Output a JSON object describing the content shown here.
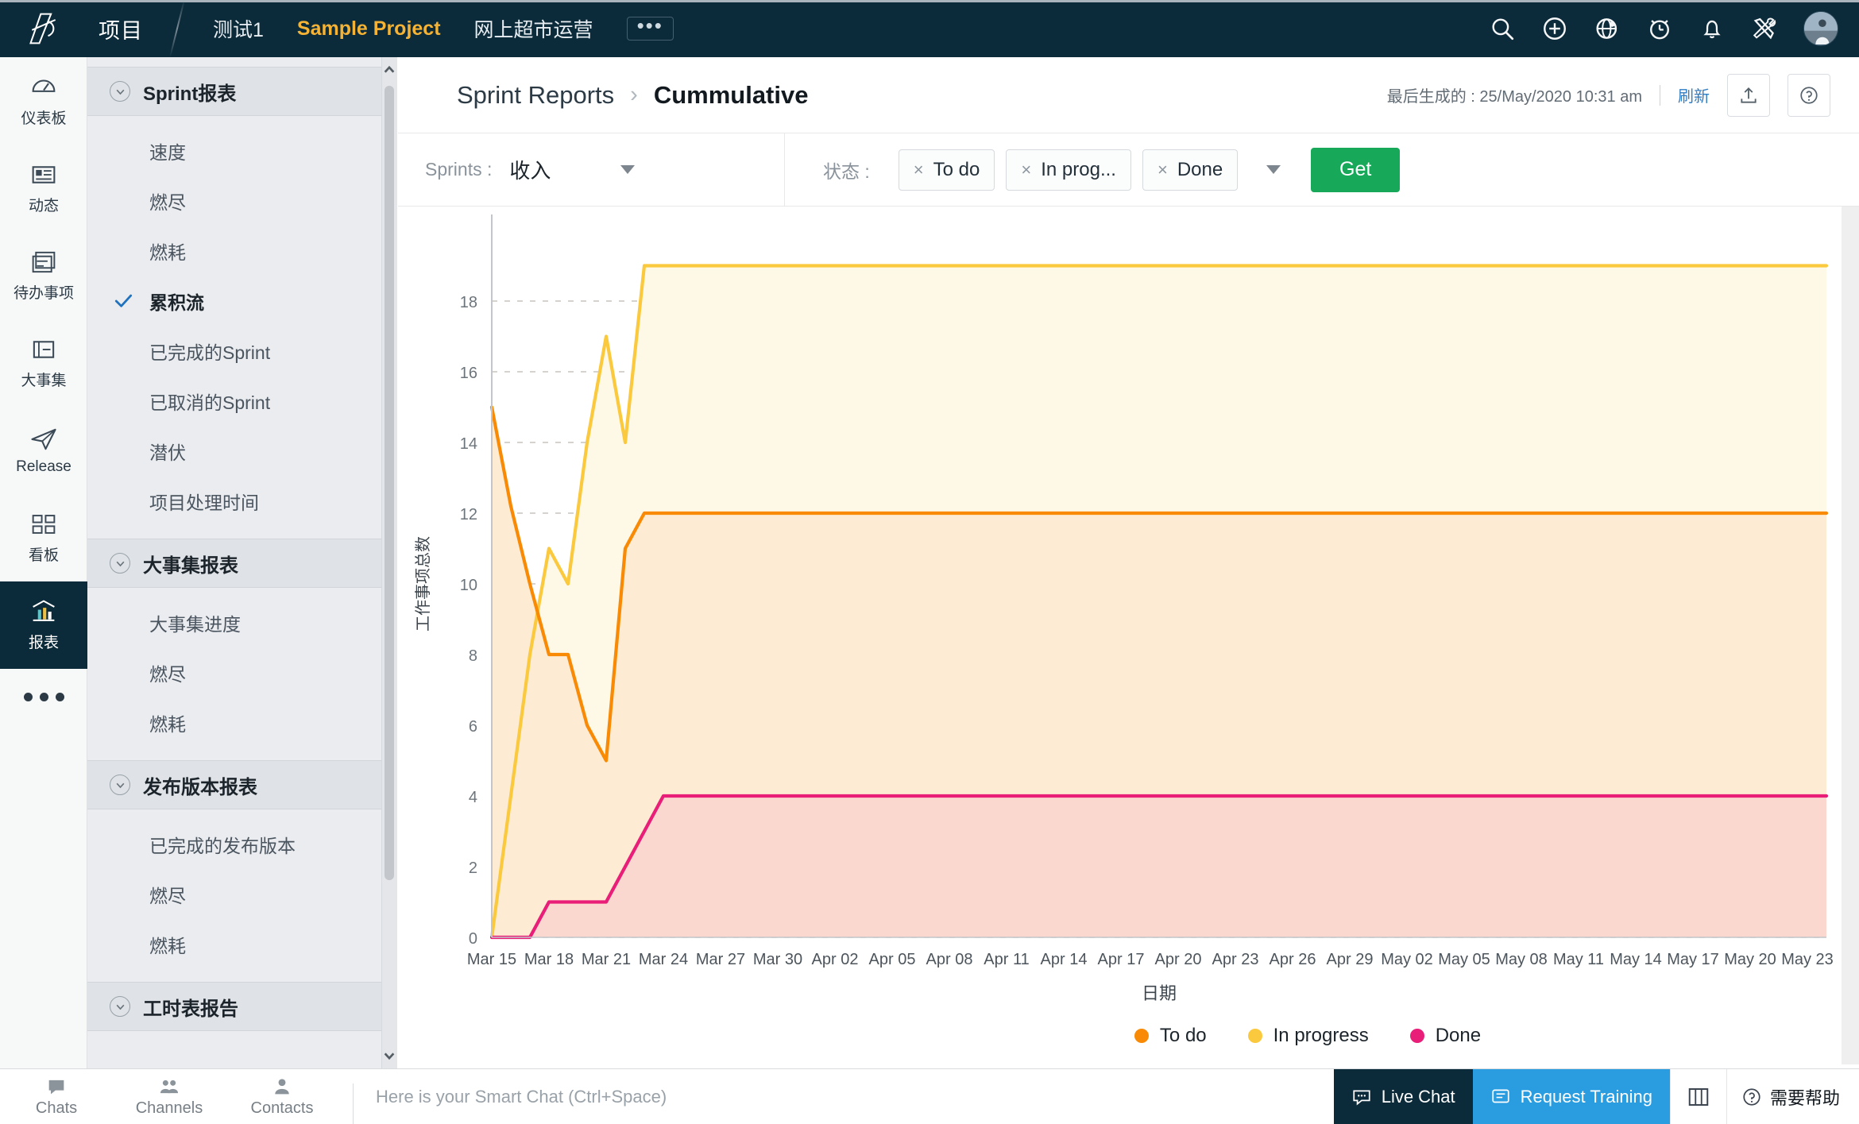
{
  "topbar": {
    "brand_title": "项目",
    "logo_icon": "app-logo-icon",
    "project_tabs": [
      {
        "label": "测试1",
        "active": false
      },
      {
        "label": "Sample Project",
        "active": true
      },
      {
        "label": "网上超市运营",
        "active": false
      }
    ],
    "more_label": "•••",
    "icons": [
      "search-icon",
      "add-icon",
      "globe-icon",
      "clock-icon",
      "bell-icon",
      "tools-icon"
    ],
    "accent_color": "#f5b335",
    "bar_color": "#0b2a3a"
  },
  "rail": {
    "items": [
      {
        "label": "仪表板",
        "icon": "dashboard-icon",
        "active": false
      },
      {
        "label": "动态",
        "icon": "feed-icon",
        "active": false
      },
      {
        "label": "待办事项",
        "icon": "tasks-icon",
        "active": false
      },
      {
        "label": "大事集",
        "icon": "epic-icon",
        "active": false
      },
      {
        "label": "Release",
        "icon": "release-icon",
        "active": false
      },
      {
        "label": "看板",
        "icon": "board-icon",
        "active": false
      },
      {
        "label": "报表",
        "icon": "reports-icon",
        "active": true
      }
    ],
    "more_icon": "more-dots-icon"
  },
  "subnav": {
    "groups": [
      {
        "title": "Sprint报表",
        "items": [
          {
            "label": "速度",
            "selected": false
          },
          {
            "label": "燃尽",
            "selected": false
          },
          {
            "label": "燃耗",
            "selected": false
          },
          {
            "label": "累积流",
            "selected": true
          },
          {
            "label": "已完成的Sprint",
            "selected": false
          },
          {
            "label": "已取消的Sprint",
            "selected": false
          },
          {
            "label": "潜伏",
            "selected": false
          },
          {
            "label": "项目处理时间",
            "selected": false
          }
        ]
      },
      {
        "title": "大事集报表",
        "items": [
          {
            "label": "大事集进度",
            "selected": false
          },
          {
            "label": "燃尽",
            "selected": false
          },
          {
            "label": "燃耗",
            "selected": false
          }
        ]
      },
      {
        "title": "发布版本报表",
        "items": [
          {
            "label": "已完成的发布版本",
            "selected": false
          },
          {
            "label": "燃尽",
            "selected": false
          },
          {
            "label": "燃耗",
            "selected": false
          }
        ]
      },
      {
        "title": "工时表报告",
        "items": []
      }
    ]
  },
  "content_header": {
    "breadcrumb_parent": "Sprint Reports",
    "breadcrumb_sep": "›",
    "breadcrumb_current": "Cummulative",
    "generated_text": "最后生成的 : 25/May/2020 10:31 am",
    "refresh_label": "刷新",
    "export_icon": "export-icon",
    "help_icon": "help-circle-icon"
  },
  "filters": {
    "sprints_label": "Sprints :",
    "sprints_value": "收入",
    "status_label": "状态 :",
    "status_chips": [
      "To do",
      "In prog...",
      "Done"
    ],
    "chip_remove_glyph": "×",
    "get_label": "Get",
    "get_color": "#17a85a"
  },
  "chart_data": {
    "type": "area",
    "title": "",
    "xlabel": "日期",
    "ylabel": "工作事项总数",
    "ylim": [
      0,
      20
    ],
    "y_ticks": [
      0,
      2,
      4,
      6,
      8,
      10,
      12,
      14,
      16,
      18
    ],
    "grid": true,
    "legend_position": "bottom",
    "x_tick_labels": [
      "Mar 15",
      "Mar 18",
      "Mar 21",
      "Mar 24",
      "Mar 27",
      "Mar 30",
      "Apr 02",
      "Apr 05",
      "Apr 08",
      "Apr 11",
      "Apr 14",
      "Apr 17",
      "Apr 20",
      "Apr 23",
      "Apr 26",
      "Apr 29",
      "May 02",
      "May 05",
      "May 08",
      "May 11",
      "May 14",
      "May 17",
      "May 20",
      "May 23"
    ],
    "x_start_date": "Mar 15",
    "x_end_date": "May 23",
    "x_day_count": 70,
    "series": [
      {
        "name": "To do",
        "color": "#f98a06",
        "fill": "#fdecd3",
        "stacked_top_values": [
          15,
          12.2,
          10,
          8,
          8,
          6,
          5,
          11,
          12,
          12,
          12,
          12,
          12,
          12,
          12,
          12,
          12,
          12,
          12,
          12,
          12,
          12,
          12,
          12,
          12,
          12,
          12,
          12,
          12,
          12,
          12,
          12,
          12,
          12,
          12,
          12,
          12,
          12,
          12,
          12,
          12,
          12,
          12,
          12,
          12,
          12,
          12,
          12,
          12,
          12,
          12,
          12,
          12,
          12,
          12,
          12,
          12,
          12,
          12,
          12,
          12,
          12,
          12,
          12,
          12,
          12,
          12,
          12,
          12,
          12,
          12
        ]
      },
      {
        "name": "In progress",
        "color": "#fbc93d",
        "fill": "#fef8e6",
        "stacked_top_values": [
          0,
          4,
          8,
          11,
          10,
          14,
          17,
          14,
          19,
          19,
          19,
          19,
          19,
          19,
          19,
          19,
          19,
          19,
          19,
          19,
          19,
          19,
          19,
          19,
          19,
          19,
          19,
          19,
          19,
          19,
          19,
          19,
          19,
          19,
          19,
          19,
          19,
          19,
          19,
          19,
          19,
          19,
          19,
          19,
          19,
          19,
          19,
          19,
          19,
          19,
          19,
          19,
          19,
          19,
          19,
          19,
          19,
          19,
          19,
          19,
          19,
          19,
          19,
          19,
          19,
          19,
          19,
          19,
          19,
          19,
          19
        ]
      },
      {
        "name": "Done",
        "color": "#e91e78",
        "fill": "#fbd8cf",
        "stacked_top_values": [
          0,
          0,
          0,
          1,
          1,
          1,
          1,
          2,
          3,
          4,
          4,
          4,
          4,
          4,
          4,
          4,
          4,
          4,
          4,
          4,
          4,
          4,
          4,
          4,
          4,
          4,
          4,
          4,
          4,
          4,
          4,
          4,
          4,
          4,
          4,
          4,
          4,
          4,
          4,
          4,
          4,
          4,
          4,
          4,
          4,
          4,
          4,
          4,
          4,
          4,
          4,
          4,
          4,
          4,
          4,
          4,
          4,
          4,
          4,
          4,
          4,
          4,
          4,
          4,
          4,
          4,
          4,
          4,
          4,
          4,
          4
        ]
      }
    ],
    "legend": [
      {
        "label": "To do",
        "color": "#f98a06"
      },
      {
        "label": "In progress",
        "color": "#fbc93d"
      },
      {
        "label": "Done",
        "color": "#e91e78"
      }
    ]
  },
  "bottombar": {
    "tabs": [
      {
        "label": "Chats",
        "icon": "chat-bubble-icon"
      },
      {
        "label": "Channels",
        "icon": "channels-icon"
      },
      {
        "label": "Contacts",
        "icon": "contact-icon"
      }
    ],
    "smart_chat_placeholder": "Here is your Smart Chat (Ctrl+Space)",
    "live_chat_label": "Live Chat",
    "request_training_label": "Request Training",
    "layout_icon": "layout-icon",
    "help_label": "需要帮助",
    "help_icon": "help-circle-icon"
  }
}
